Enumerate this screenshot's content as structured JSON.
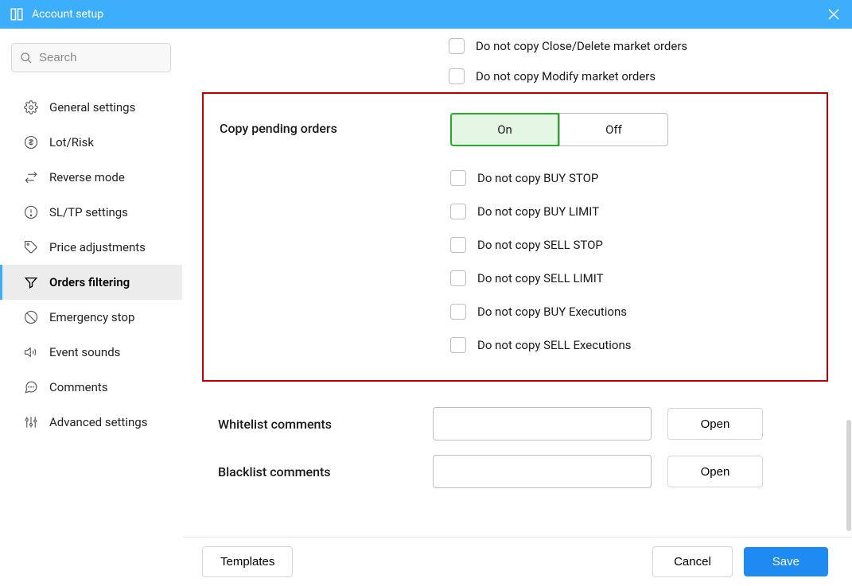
{
  "titlebar": {
    "title": "Account setup"
  },
  "sidebar": {
    "search_placeholder": "Search",
    "items": [
      {
        "label": "General settings"
      },
      {
        "label": "Lot/Risk"
      },
      {
        "label": "Reverse mode"
      },
      {
        "label": "SL/TP settings"
      },
      {
        "label": "Price adjustments"
      },
      {
        "label": "Orders filtering"
      },
      {
        "label": "Emergency stop"
      },
      {
        "label": "Event sounds"
      },
      {
        "label": "Comments"
      },
      {
        "label": "Advanced settings"
      }
    ]
  },
  "top_checks": [
    "Do not copy Close/Delete market orders",
    "Do not copy Modify market orders"
  ],
  "pending": {
    "label": "Copy pending orders",
    "on": "On",
    "off": "Off",
    "checks": [
      "Do not copy BUY STOP",
      "Do not copy BUY LIMIT",
      "Do not copy SELL STOP",
      "Do not copy SELL LIMIT",
      "Do not copy BUY Executions",
      "Do not copy SELL Executions"
    ]
  },
  "whitelist": {
    "label": "Whitelist comments",
    "open": "Open"
  },
  "blacklist": {
    "label": "Blacklist comments",
    "open": "Open"
  },
  "footer": {
    "templates": "Templates",
    "cancel": "Cancel",
    "save": "Save"
  }
}
